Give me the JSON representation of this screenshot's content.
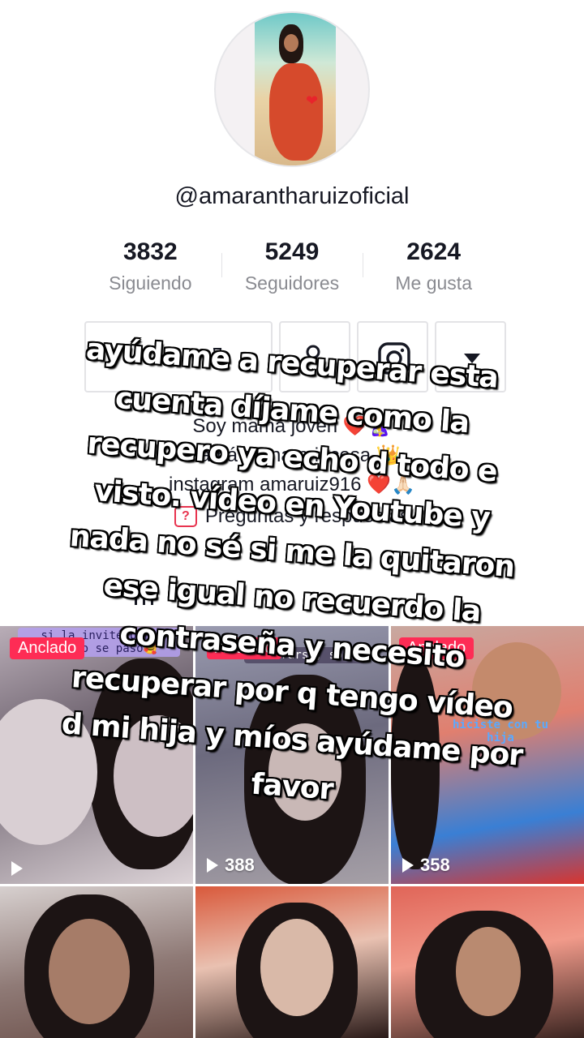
{
  "profile": {
    "username": "@amarantharuizoficial"
  },
  "stats": [
    {
      "value": "3832",
      "label": "Siguiendo"
    },
    {
      "value": "5249",
      "label": "Seguidores"
    },
    {
      "value": "2624",
      "label": "Me gusta"
    }
  ],
  "buttons": {
    "icons": [
      "pin-icon",
      "person-check-icon",
      "instagram-icon",
      "caret-down-icon"
    ]
  },
  "bio": {
    "line1": "Soy mamá joven ❤️🤱",
    "line2": "mamá d una princesa 👑",
    "line3": "instagram amaruiz916 ❤️🙏🏻",
    "qa_label": "Preguntas y respuestas"
  },
  "videos": [
    {
      "pinned": "Anclado",
      "caption": "si la invité pero contigo se pasó🥰",
      "views": ""
    },
    {
      "pinned": "Anclado",
      "caption": "amarrarse, solo",
      "views": "388"
    },
    {
      "pinned": "Anclado",
      "caption": "hiciste con tu hija",
      "views": "358"
    },
    {
      "pinned": "",
      "caption": "",
      "views": ""
    },
    {
      "pinned": "",
      "caption": "",
      "views": ""
    },
    {
      "pinned": "",
      "caption": "",
      "views": ""
    }
  ],
  "overlay_text": [
    "ayúdame a recuperar esta",
    "cuenta díjame como la",
    "recupero ya echo d todo e",
    "visto. vídeo en Youtube y",
    "nada no sé si me la quitaron",
    "ese igual no recuerdo la",
    "contraseña y necesito",
    "recuperar por q tengo vídeo",
    "d mi hija y míos ayúdame por",
    "favor"
  ],
  "colors": {
    "pinned_badge": "#fe2c55",
    "text_primary": "#161823",
    "text_secondary": "#8a8b91"
  }
}
